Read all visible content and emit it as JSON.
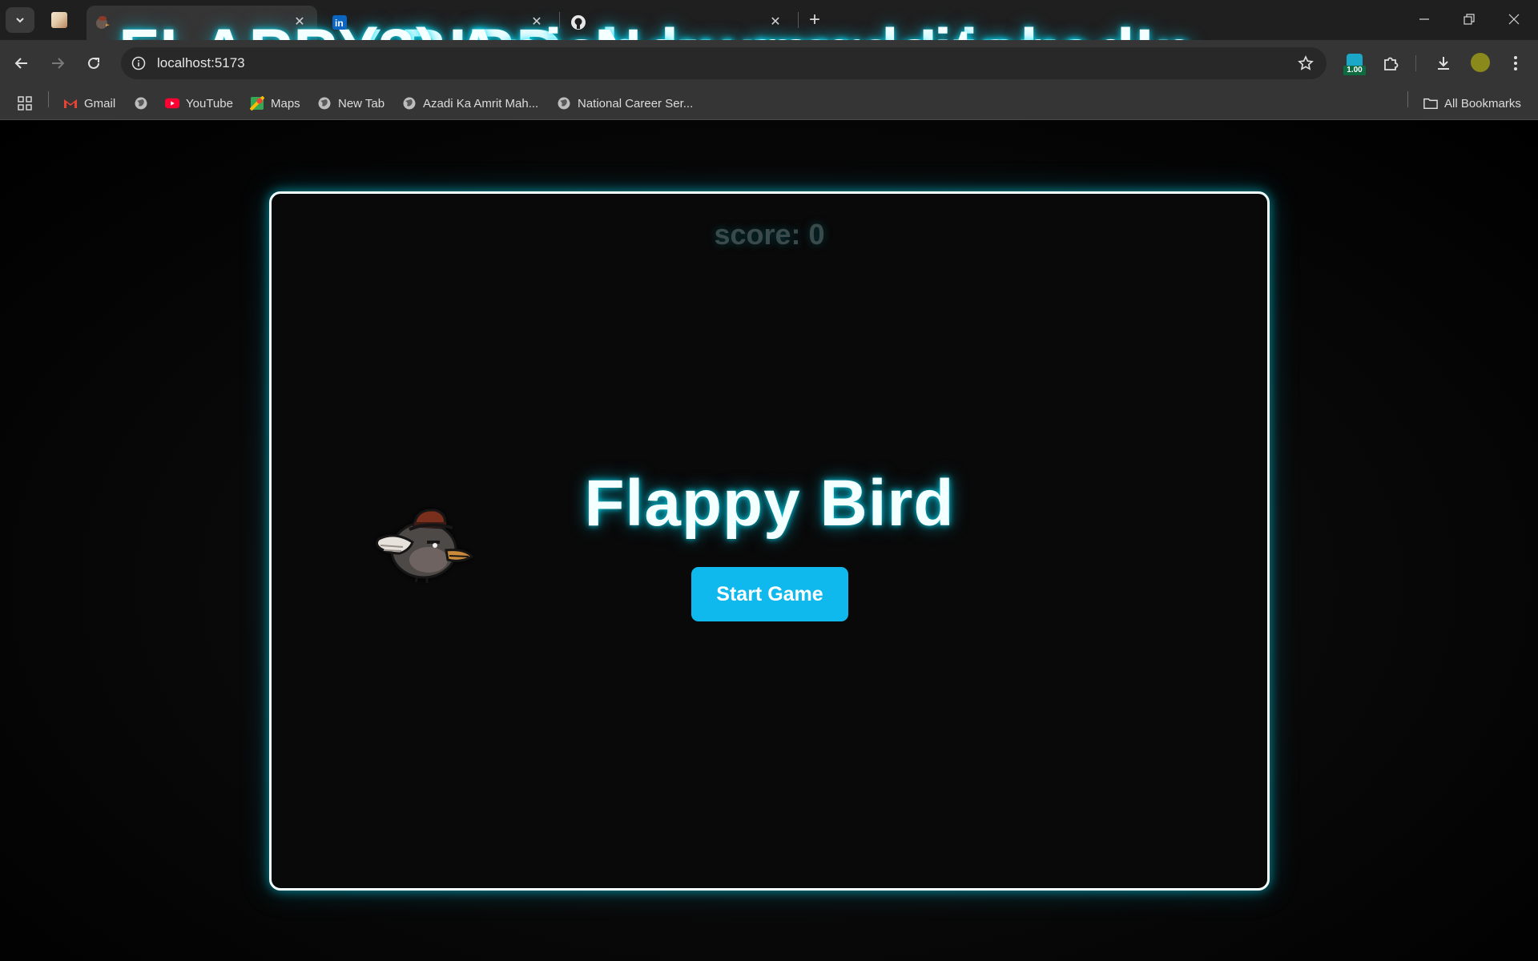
{
  "browser": {
    "tabs": [
      {
        "title": "FLAPPY BIRD",
        "active": true,
        "favicon": "bird-favicon-icon"
      },
      {
        "title": "(3) Anish kumar | LinkedIn",
        "active": false,
        "favicon": "linkedin-icon"
      },
      {
        "title": "New repository",
        "active": false,
        "favicon": "github-icon"
      }
    ],
    "url": "localhost:5173",
    "extension_badge": "1.00",
    "bookmarks": [
      {
        "label": "Gmail",
        "icon": "gmail-icon"
      },
      {
        "label": "",
        "icon": "globe-icon"
      },
      {
        "label": "YouTube",
        "icon": "youtube-icon"
      },
      {
        "label": "Maps",
        "icon": "maps-icon"
      },
      {
        "label": "New Tab",
        "icon": "globe-icon"
      },
      {
        "label": "Azadi Ka Amrit Mah...",
        "icon": "globe-icon"
      },
      {
        "label": "National Career Ser...",
        "icon": "globe-icon"
      }
    ],
    "all_bookmarks": "All Bookmarks"
  },
  "game": {
    "score_label": "score: 0",
    "score": 0,
    "title": "Flappy Bird",
    "start_button": "Start Game"
  },
  "colors": {
    "accent": "#0fb9ee",
    "glow": "#00e6ff",
    "frame": "#f2ffff"
  }
}
